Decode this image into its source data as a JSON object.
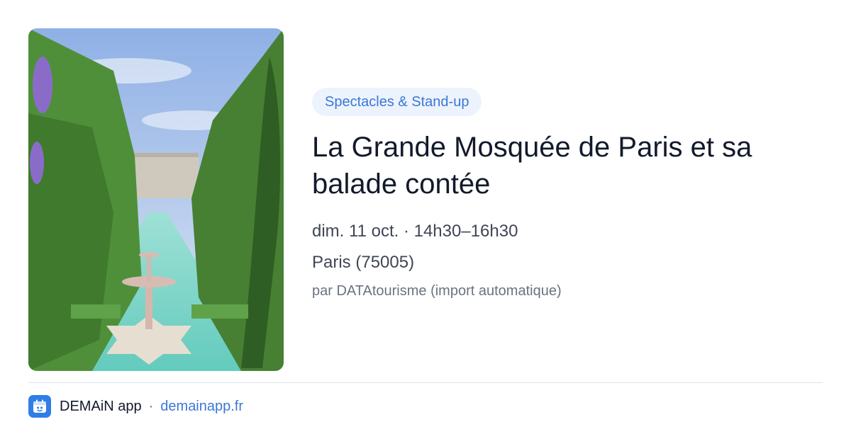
{
  "event": {
    "category": "Spectacles & Stand-up",
    "title": "La Grande Mosquée de Paris et sa balade contée",
    "when": "dim. 11 oct. · 14h30–16h30",
    "where": "Paris (75005)",
    "source": "par DATAtourisme (import automatique)"
  },
  "footer": {
    "app_name": "DEMAiN app",
    "separator": "·",
    "link": "demainapp.fr"
  },
  "icons": {
    "app": "demain-app-icon"
  },
  "colors": {
    "accent": "#3b78d8",
    "badge_bg": "#edf3fc",
    "title": "#121a2b",
    "app_icon": "#2f7ee6"
  }
}
